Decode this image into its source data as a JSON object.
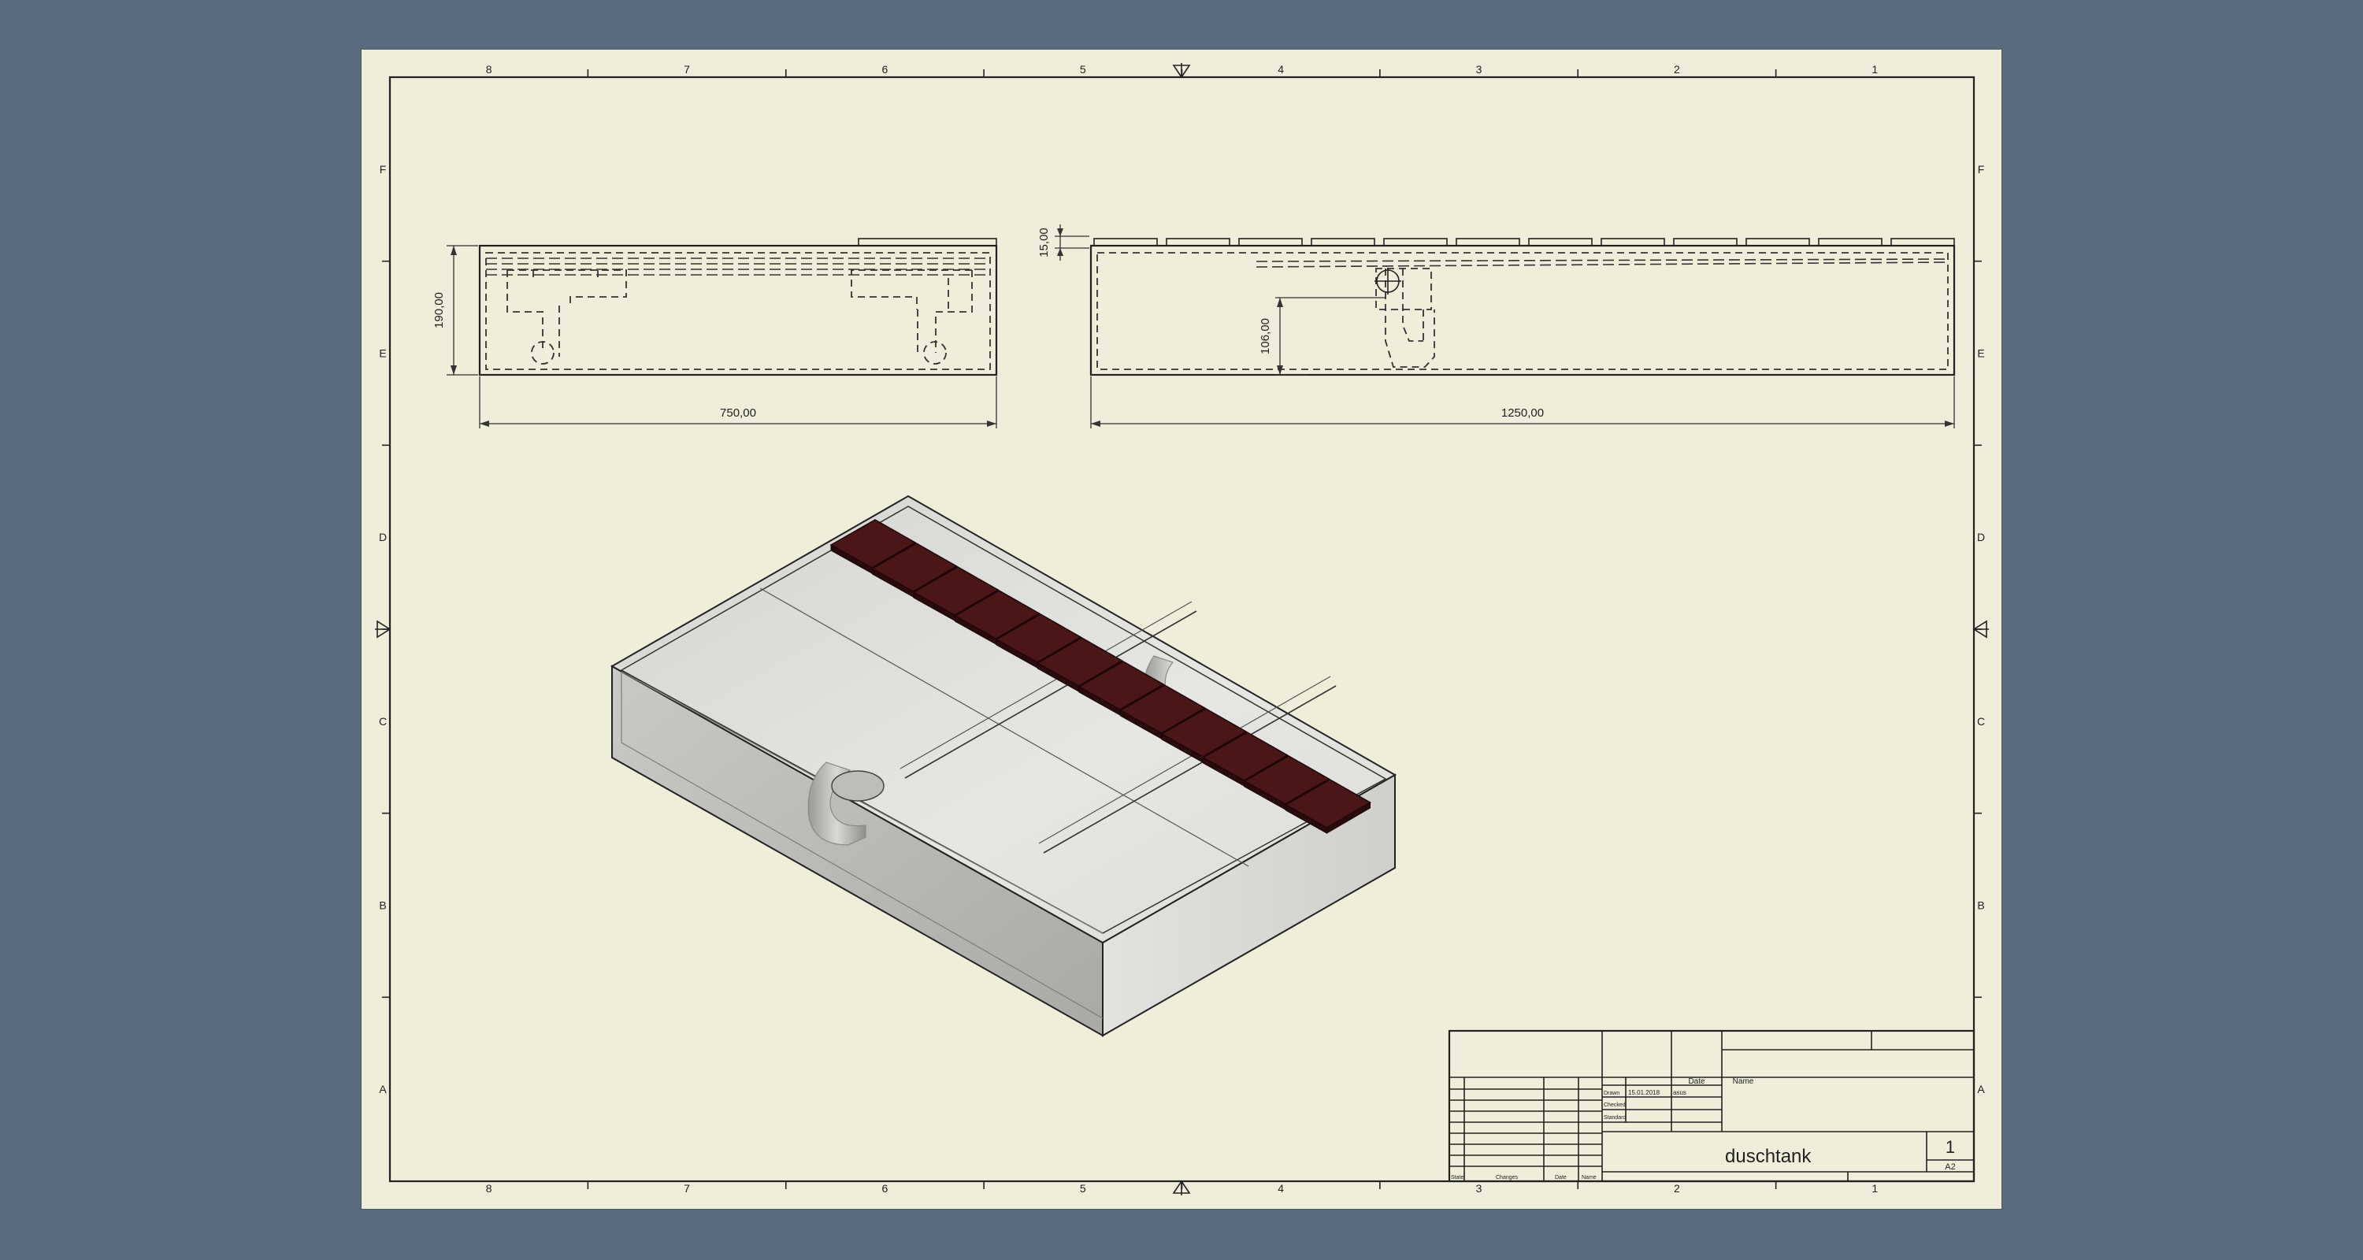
{
  "drawing": {
    "title": "duschtank",
    "sheet_number": "1",
    "sheet_size": "A2",
    "zone_columns": [
      "8",
      "7",
      "6",
      "5",
      "4",
      "3",
      "2",
      "1"
    ],
    "zone_rows": [
      "F",
      "E",
      "D",
      "C",
      "B",
      "A"
    ]
  },
  "dimensions": {
    "front_height": "190,00",
    "front_width": "750,00",
    "side_grate": "15,00",
    "side_drain_height": "106,00",
    "side_width": "1250,00"
  },
  "title_block": {
    "col_date": "Date",
    "col_name": "Name",
    "row_drawn": "Drawn",
    "row_checked": "Checked",
    "row_standard": "Standard",
    "drawn_date": "15.01.2018",
    "drawn_name": "asus",
    "rev_state": "State",
    "rev_changes": "Changes",
    "rev_date": "Date",
    "rev_name": "Name"
  },
  "colors": {
    "background": "#5a6b7e",
    "sheet": "#eeeedb",
    "line": "#222222",
    "grate": "#4a1618"
  }
}
